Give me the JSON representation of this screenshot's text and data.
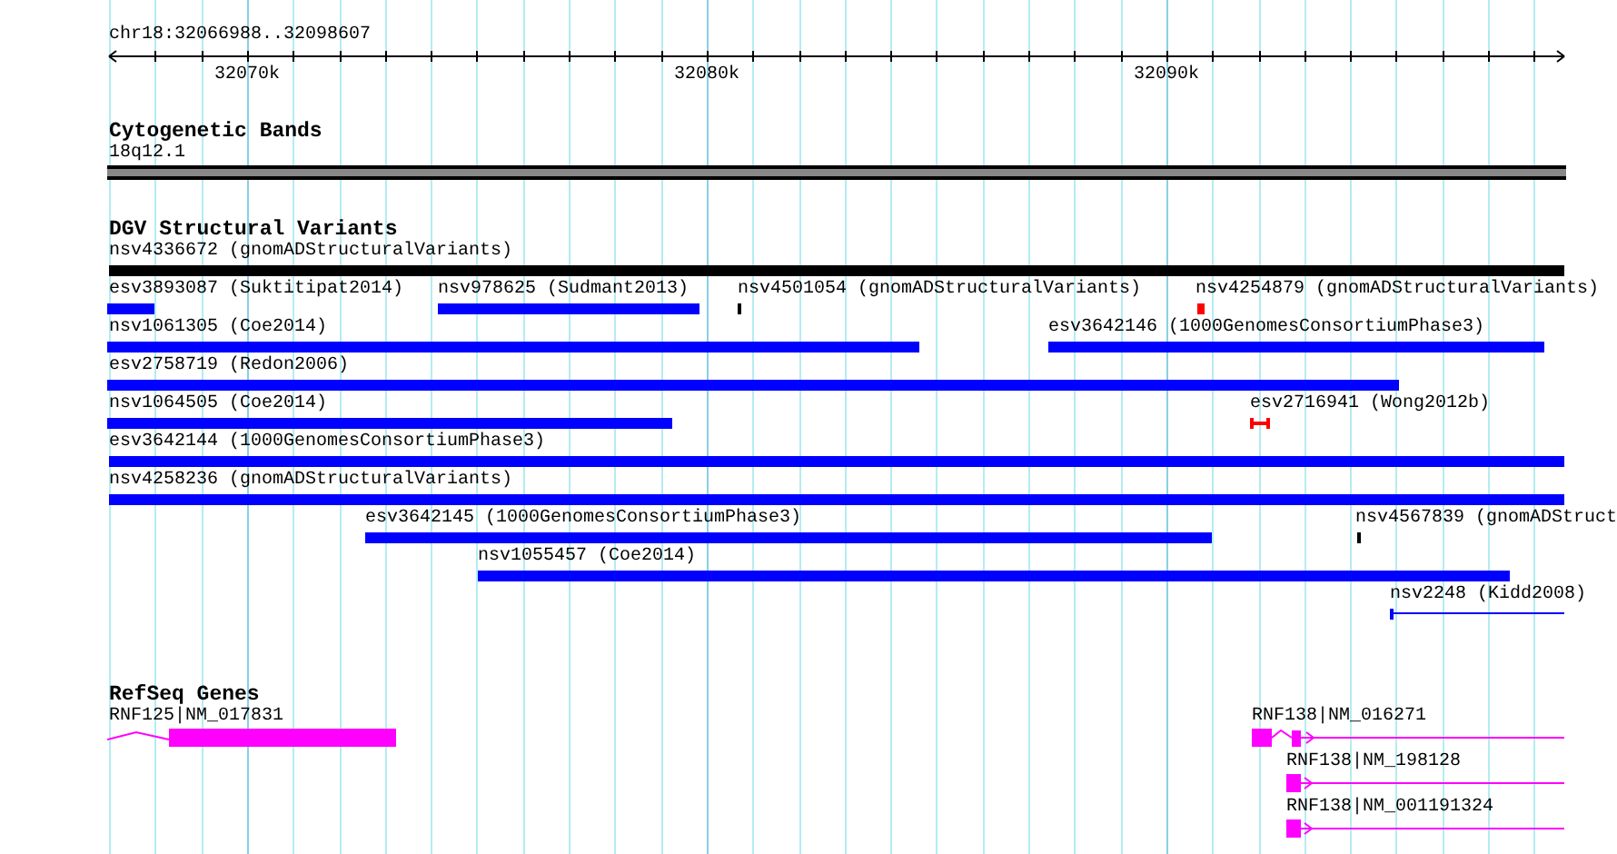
{
  "ruler": {
    "position": "chr18:32066988..32098607",
    "tick_labels": [
      "32070k",
      "32080k",
      "32090k"
    ]
  },
  "cytogenetic_bands": {
    "title": "Cytogenetic Bands",
    "band": {
      "label": "18q12.1"
    }
  },
  "dgv": {
    "title": "DGV Structural Variants",
    "variants": [
      {
        "label": "nsv4336672 (gnomADStructuralVariants)",
        "kind": "bar",
        "color": "#000000"
      },
      {
        "label": "esv3893087 (Suktitipat2014)",
        "kind": "bar",
        "color": "#0000ff"
      },
      {
        "label": "nsv978625 (Sudmant2013)",
        "kind": "bar",
        "color": "#0000ff"
      },
      {
        "label": "nsv4501054 (gnomADStructuralVariants)",
        "kind": "tick",
        "color": "#000000"
      },
      {
        "label": "nsv4254879 (gnomADStructuralVariants)",
        "kind": "bar",
        "color": "#ff0000"
      },
      {
        "label": "nsv1061305 (Coe2014)",
        "kind": "bar",
        "color": "#0000ff"
      },
      {
        "label": "esv3642146 (1000GenomesConsortiumPhase3)",
        "kind": "bar",
        "color": "#0000ff"
      },
      {
        "label": "esv2758719 (Redon2006)",
        "kind": "bar",
        "color": "#0000ff"
      },
      {
        "label": "nsv1064505 (Coe2014)",
        "kind": "bar",
        "color": "#0000ff"
      },
      {
        "label": "esv2716941 (Wong2012b)",
        "kind": "span",
        "color": "#ff0000"
      },
      {
        "label": "esv3642144 (1000GenomesConsortiumPhase3)",
        "kind": "bar",
        "color": "#0000ff"
      },
      {
        "label": "nsv4258236 (gnomADStructuralVariants)",
        "kind": "bar",
        "color": "#0000ff"
      },
      {
        "label": "esv3642145 (1000GenomesConsortiumPhase3)",
        "kind": "bar",
        "color": "#0000ff"
      },
      {
        "label": "nsv4567839 (gnomADStruct",
        "kind": "tick",
        "color": "#000000"
      },
      {
        "label": "nsv1055457 (Coe2014)",
        "kind": "bar",
        "color": "#0000ff"
      },
      {
        "label": "nsv2248 (Kidd2008)",
        "kind": "line",
        "color": "#0000ff"
      }
    ]
  },
  "refseq": {
    "title": "RefSeq Genes",
    "genes": [
      {
        "label": "RNF125|NM_017831"
      },
      {
        "label": "RNF138|NM_016271"
      },
      {
        "label": "RNF138|NM_198128"
      },
      {
        "label": "RNF138|NM_001191324"
      }
    ]
  }
}
